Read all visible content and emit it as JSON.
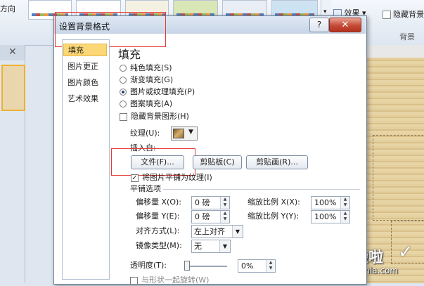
{
  "ribbon": {
    "direction_label": "方向",
    "effects_label": "效果",
    "effects_arrow": "▾",
    "hide_bg_label": "隐藏背景",
    "bg_group_label": "背景",
    "scroll_glyph": "▾"
  },
  "left_panel": {
    "close_glyph": "✕"
  },
  "dialog": {
    "title": "设置背景格式",
    "help_glyph": "?",
    "close_glyph": "✕",
    "nav": [
      "填充",
      "图片更正",
      "图片颜色",
      "艺术效果"
    ],
    "heading": "填充",
    "fill_options": [
      {
        "label": "纯色填充(S)",
        "selected": false
      },
      {
        "label": "渐变填充(G)",
        "selected": false
      },
      {
        "label": "图片或纹理填充(P)",
        "selected": true
      },
      {
        "label": "图案填充(A)",
        "selected": false
      }
    ],
    "hide_bg_graphics": "隐藏背景图形(H)",
    "texture_label": "纹理(U):",
    "insert_from_label": "插入自:",
    "buttons": {
      "file": "文件(F)...",
      "clipboard": "剪贴板(C)",
      "clipart": "剪贴画(R)..."
    },
    "tile_check": "将图片平铺为纹理(I)",
    "tile_section": "平铺选项",
    "offset_x_label": "偏移量 X(O):",
    "offset_x_value": "0 磅",
    "offset_y_label": "偏移量 Y(E):",
    "offset_y_value": "0 磅",
    "scale_x_label": "缩放比例 X(X):",
    "scale_x_value": "100%",
    "scale_y_label": "缩放比例 Y(Y):",
    "scale_y_value": "100%",
    "align_label": "对齐方式(L):",
    "align_value": "左上对齐",
    "mirror_label": "镜像类型(M):",
    "mirror_value": "无",
    "transparency_label": "透明度(T):",
    "transparency_value": "0%",
    "rotate_with_shape": "与形状一起旋转(W)"
  },
  "watermark": {
    "main": "经验啦",
    "sub": "jingyanla.com",
    "check": "✓"
  },
  "colors": {
    "highlight_red": "#e53935",
    "selected_nav": "#fbd775",
    "close_red": "#c44b37"
  }
}
